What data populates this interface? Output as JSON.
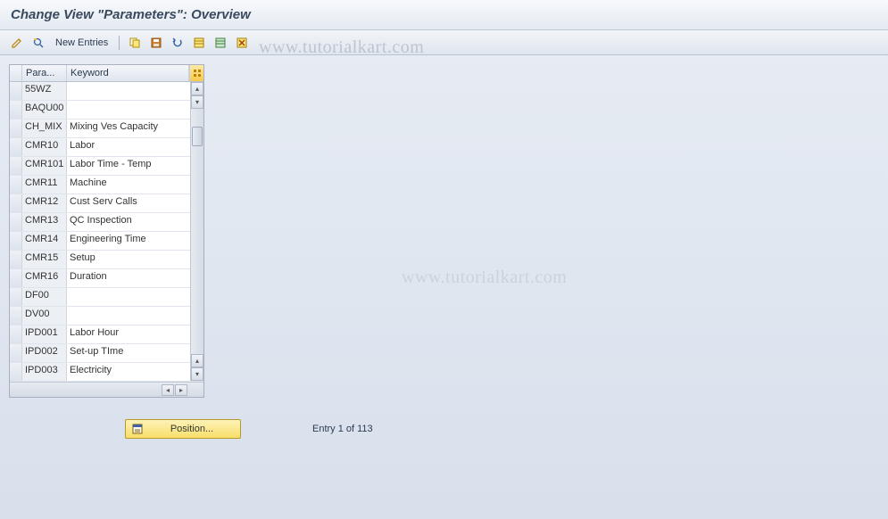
{
  "title": "Change View \"Parameters\": Overview",
  "toolbar": {
    "new_entries_label": "New Entries"
  },
  "table": {
    "headers": {
      "param": "Para...",
      "keyword": "Keyword"
    },
    "rows": [
      {
        "param": "55WZ",
        "keyword": ""
      },
      {
        "param": "BAQU00",
        "keyword": ""
      },
      {
        "param": "CH_MIX",
        "keyword": "Mixing Ves Capacity"
      },
      {
        "param": "CMR10",
        "keyword": "Labor"
      },
      {
        "param": "CMR101",
        "keyword": "Labor Time - Temp"
      },
      {
        "param": "CMR11",
        "keyword": "Machine"
      },
      {
        "param": "CMR12",
        "keyword": "Cust Serv Calls"
      },
      {
        "param": "CMR13",
        "keyword": "QC Inspection"
      },
      {
        "param": "CMR14",
        "keyword": "Engineering Time"
      },
      {
        "param": "CMR15",
        "keyword": "Setup"
      },
      {
        "param": "CMR16",
        "keyword": "Duration"
      },
      {
        "param": "DF00",
        "keyword": ""
      },
      {
        "param": "DV00",
        "keyword": ""
      },
      {
        "param": "IPD001",
        "keyword": "Labor Hour"
      },
      {
        "param": "IPD002",
        "keyword": "Set-up TIme"
      },
      {
        "param": "IPD003",
        "keyword": "Electricity"
      }
    ]
  },
  "footer": {
    "position_label": "Position...",
    "entry_text": "Entry 1 of 113"
  },
  "watermark": "www.tutorialkart.com"
}
